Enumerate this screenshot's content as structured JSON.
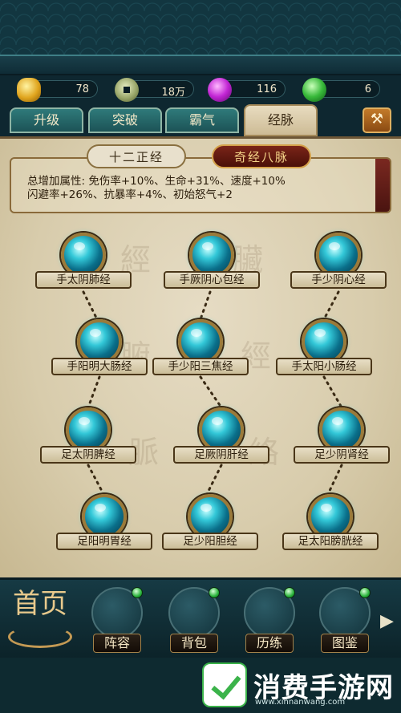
{
  "currencies": [
    {
      "name": "gold-ingot",
      "value": "78",
      "icon": "gold-ingot-icon"
    },
    {
      "name": "copper-coin",
      "value": "18万",
      "icon": "copper-coin-icon"
    },
    {
      "name": "purple-gem",
      "value": "116",
      "icon": "purple-gem-icon"
    },
    {
      "name": "green-gem",
      "value": "6",
      "icon": "green-gem-icon"
    }
  ],
  "tabs": [
    {
      "label": "升级",
      "active": false
    },
    {
      "label": "突破",
      "active": false
    },
    {
      "label": "霸气",
      "active": false
    },
    {
      "label": "经脉",
      "active": true
    }
  ],
  "subtabs": {
    "left": "十二正经",
    "right": "奇经八脉"
  },
  "attributes": {
    "line1": "总增加属性: 免伤率+10%、生命+31%、速度+10%",
    "line2": "闪避率+26%、抗暴率+4%、初始怒气+2"
  },
  "meridians": [
    {
      "label": "手太阴肺经"
    },
    {
      "label": "手厥阴心包经"
    },
    {
      "label": "手少阴心经"
    },
    {
      "label": "手阳明大肠经"
    },
    {
      "label": "手少阳三焦经"
    },
    {
      "label": "手太阳小肠经"
    },
    {
      "label": "足太阴脾经"
    },
    {
      "label": "足厥阴肝经"
    },
    {
      "label": "足少阴肾经"
    },
    {
      "label": "足阳明胃经"
    },
    {
      "label": "足少阳胆经"
    },
    {
      "label": "足太阳膀胱经"
    }
  ],
  "nav": {
    "home": "首页",
    "items": [
      {
        "label": "阵容",
        "icon": "formation-scroll-icon",
        "badge": true
      },
      {
        "label": "背包",
        "icon": "treasure-chest-icon",
        "badge": true
      },
      {
        "label": "历练",
        "icon": "crossed-swords-icon",
        "badge": true
      },
      {
        "label": "图鉴",
        "icon": "map-scroll-icon",
        "badge": true
      }
    ]
  },
  "watermark": {
    "title": "消费手游网",
    "url": "www.xinnanwang.com"
  },
  "colors": {
    "frame": "#0f2a33",
    "parchment": "#ddd2b6",
    "tab_teal": "#2f7a7a",
    "orb_cyan": "#33c8d8",
    "accent_red": "#7a2418",
    "gold_border": "#9a7a3a"
  }
}
